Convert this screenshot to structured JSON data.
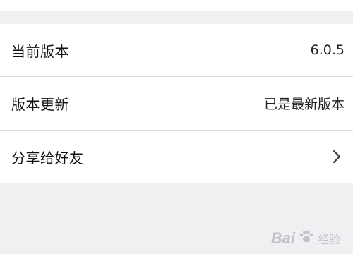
{
  "settings": {
    "rows": [
      {
        "label": "当前版本",
        "value": "6.0.5"
      },
      {
        "label": "版本更新",
        "value": "已是最新版本"
      },
      {
        "label": "分享给好友",
        "icon": "chevron-right-icon"
      }
    ]
  },
  "watermark": {
    "text": "Bai",
    "sub": "经验"
  },
  "colors": {
    "background": "#f0f0f2",
    "card": "#ffffff",
    "divider": "#dcdcdc"
  }
}
